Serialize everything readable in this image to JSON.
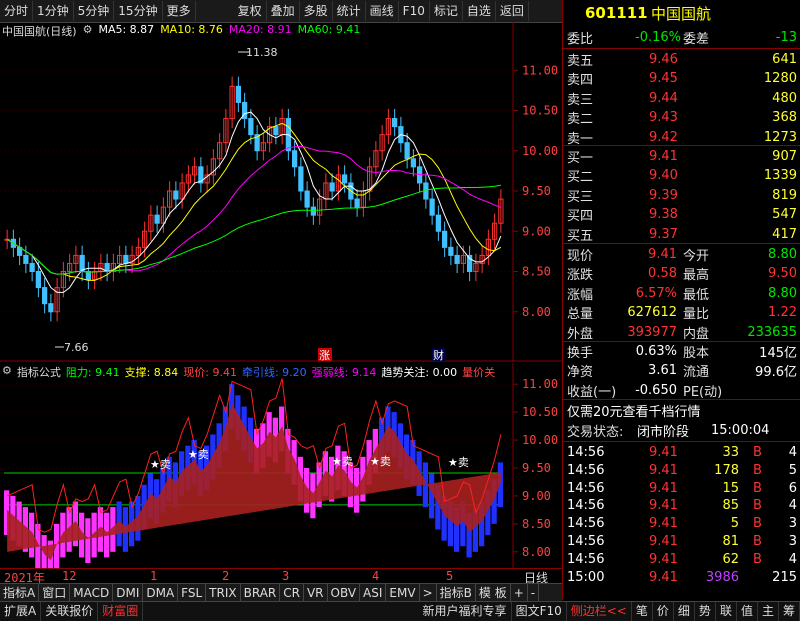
{
  "toolbar": {
    "left_items": [
      "分时",
      "1分钟",
      "5分钟",
      "15分钟",
      "更多"
    ],
    "right_items": [
      "复权",
      "叠加",
      "多股",
      "统计",
      "画线",
      "F10",
      "标记",
      "自选",
      "返回"
    ]
  },
  "chart_header": {
    "name": "中国国航(日线)",
    "ma5": "MA5: 8.87",
    "ma10": "MA10: 8.76",
    "ma20": "MA20: 8.91",
    "ma60": "MA60: 9.41"
  },
  "chart_data": [
    {
      "type": "candlestick",
      "title": "中国国航(日线)",
      "ylim": [
        7.5,
        11.5
      ],
      "y_ticks": [
        "11.00",
        "10.50",
        "10.00",
        "9.50",
        "9.00",
        "8.50",
        "8.00"
      ],
      "annotations": {
        "high": "11.38",
        "low": "7.66"
      },
      "markers": [
        "涨",
        "财"
      ],
      "series": [
        {
          "name": "MA5",
          "color": "#ffffff"
        },
        {
          "name": "MA10",
          "color": "#ffff00"
        },
        {
          "name": "MA20",
          "color": "#ff00ff"
        },
        {
          "name": "MA60",
          "color": "#00ff00"
        }
      ]
    },
    {
      "type": "indicator",
      "ylim": [
        7.8,
        11.2
      ],
      "y_ticks": [
        "11.00",
        "10.50",
        "10.00",
        "9.50",
        "9.00",
        "8.50",
        "8.00"
      ],
      "marker_label": "卖"
    }
  ],
  "indicator_header": {
    "name": "指标公式",
    "resistance": "阻力: 9.41",
    "support": "支撑: 8.84",
    "price": "现价: 9.41",
    "guide": "牵引线: 9.20",
    "strong_weak": "强弱线: 9.14",
    "trend": "趋势关注: 0.00",
    "volume": "量价关"
  },
  "time_axis": {
    "labels": [
      "2021年",
      "12",
      "1",
      "2",
      "3",
      "4",
      "5"
    ],
    "period": "日线"
  },
  "indicator_tabs": [
    "指标A",
    "窗口",
    "MACD",
    "DMI",
    "DMA",
    "FSL",
    "TRIX",
    "BRAR",
    "CR",
    "VR",
    "OBV",
    "ASI",
    "EMV",
    ">",
    "指标B",
    "模 板",
    "+",
    "-"
  ],
  "bottom_tabs": [
    "扩展A",
    "关联报价",
    "财富圈"
  ],
  "bottom_right_tabs": [
    "新用户福利专享",
    "图文F10",
    "侧边栏<<",
    "笔",
    "价",
    "细",
    "势",
    "联",
    "值",
    "主",
    "筹"
  ],
  "quote": {
    "code": "601111",
    "name": "中国国航",
    "weibi_label": "委比",
    "weibi": "-0.16%",
    "weicha_label": "委差",
    "weicha": "-13",
    "asks": [
      {
        "label": "卖五",
        "price": "9.46",
        "vol": "641"
      },
      {
        "label": "卖四",
        "price": "9.45",
        "vol": "1280"
      },
      {
        "label": "卖三",
        "price": "9.44",
        "vol": "480"
      },
      {
        "label": "卖二",
        "price": "9.43",
        "vol": "368"
      },
      {
        "label": "卖一",
        "price": "9.42",
        "vol": "1273"
      }
    ],
    "bids": [
      {
        "label": "买一",
        "price": "9.41",
        "vol": "907"
      },
      {
        "label": "买二",
        "price": "9.40",
        "vol": "1339"
      },
      {
        "label": "买三",
        "price": "9.39",
        "vol": "819"
      },
      {
        "label": "买四",
        "price": "9.38",
        "vol": "547"
      },
      {
        "label": "买五",
        "price": "9.37",
        "vol": "417"
      }
    ],
    "stats": [
      {
        "l1": "现价",
        "v1": "9.41",
        "c1": "red",
        "l2": "今开",
        "v2": "8.80",
        "c2": "green"
      },
      {
        "l1": "涨跌",
        "v1": "0.58",
        "c1": "red",
        "l2": "最高",
        "v2": "9.50",
        "c2": "red"
      },
      {
        "l1": "涨幅",
        "v1": "6.57%",
        "c1": "red",
        "l2": "最低",
        "v2": "8.80",
        "c2": "green"
      },
      {
        "l1": "总量",
        "v1": "627612",
        "c1": "yellow",
        "l2": "量比",
        "v2": "1.22",
        "c2": "red"
      },
      {
        "l1": "外盘",
        "v1": "393977",
        "c1": "red",
        "l2": "内盘",
        "v2": "233635",
        "c2": "green"
      }
    ],
    "fin": [
      {
        "l1": "换手",
        "v1": "0.63%",
        "l2": "股本",
        "v2": "145亿"
      },
      {
        "l1": "净资",
        "v1": "3.61",
        "l2": "流通",
        "v2": "99.6亿"
      },
      {
        "l1": "收益(一)",
        "v1": "-0.650",
        "l2": "PE(动)",
        "v2": ""
      }
    ],
    "promo": "仅需20元查看千档行情",
    "status_label": "交易状态:",
    "status": "闭市阶段",
    "status_time": "15:00:04",
    "ticks": [
      {
        "t": "14:56",
        "p": "9.41",
        "v": "33",
        "s": "B",
        "n": "4"
      },
      {
        "t": "14:56",
        "p": "9.41",
        "v": "178",
        "s": "B",
        "n": "5"
      },
      {
        "t": "14:56",
        "p": "9.41",
        "v": "15",
        "s": "B",
        "n": "6"
      },
      {
        "t": "14:56",
        "p": "9.41",
        "v": "85",
        "s": "B",
        "n": "4"
      },
      {
        "t": "14:56",
        "p": "9.41",
        "v": "5",
        "s": "B",
        "n": "3"
      },
      {
        "t": "14:56",
        "p": "9.41",
        "v": "81",
        "s": "B",
        "n": "3"
      },
      {
        "t": "14:56",
        "p": "9.41",
        "v": "62",
        "s": "B",
        "n": "4"
      },
      {
        "t": "15:00",
        "p": "9.41",
        "v": "3986",
        "s": "",
        "n": "215"
      }
    ]
  }
}
